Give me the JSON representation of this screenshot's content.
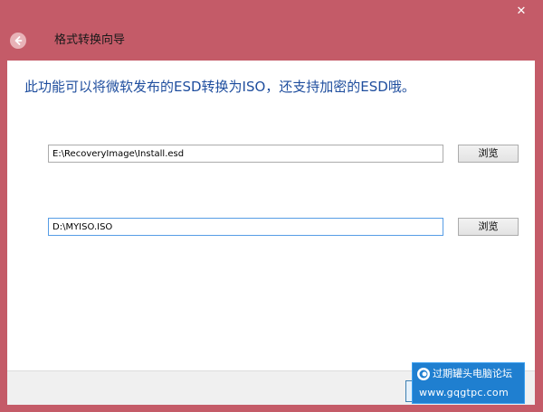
{
  "window": {
    "title": "格式转换向导",
    "close_glyph": "✕"
  },
  "content": {
    "headline": "此功能可以将微软发布的ESD转换为ISO，还支持加密的ESD哦。",
    "source": {
      "value": "E:\\RecoveryImage\\Install.esd",
      "browse_label": "浏览"
    },
    "target": {
      "value": "D:\\MYISO.ISO",
      "browse_label": "浏览"
    }
  },
  "watermark": {
    "line1": "过期罐头电脑论坛",
    "line2": "www.gqgtpc.com"
  },
  "icons": {
    "back": "back-arrow-icon",
    "close": "close-icon",
    "watermark_logo": "forum-logo-icon"
  },
  "colors": {
    "frame": "#c45b68",
    "headline": "#1f4e9e",
    "watermark_bg": "#1f7fd0"
  }
}
